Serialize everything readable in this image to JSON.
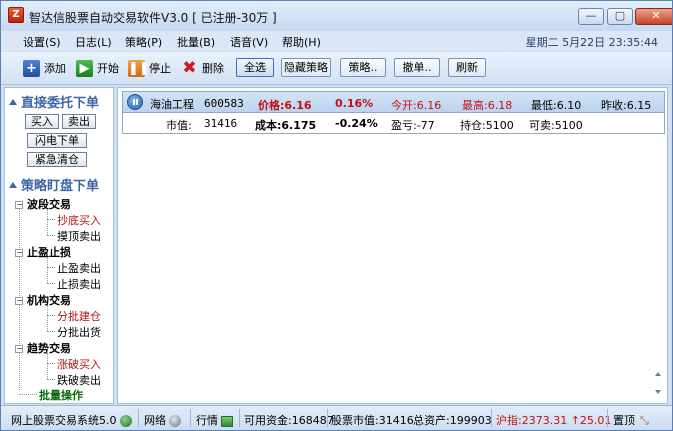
{
  "window": {
    "title": "智达信股票自动交易软件V3.0 [ 已注册-30万 ]",
    "app_icon_glyph": "Z",
    "controls": {
      "minimize": "—",
      "maximize": "▢",
      "close": "✕"
    }
  },
  "menu": {
    "items": [
      "设置(S)",
      "日志(L)",
      "策略(P)",
      "批量(B)",
      "语音(V)",
      "帮助(H)"
    ],
    "clock": "星期二  5月22日  23:35:44"
  },
  "toolbar": {
    "add": "添加",
    "start": "开始",
    "stop": "停止",
    "delete": "删除",
    "select_all": "全选",
    "hide_strategy": "隐藏策略",
    "strategy": "策略..",
    "cancel_order": "撤单..",
    "refresh": "刷新"
  },
  "left_panel": {
    "direct_title": "直接委托下单",
    "buy": "买入",
    "sell": "卖出",
    "flash_order": "闪电下单",
    "emergency_clear": "紧急清仓",
    "strategy_title": "策略盯盘下单",
    "groups": [
      {
        "label": "波段交易",
        "items": [
          {
            "label": "抄底买入",
            "color": "red"
          },
          {
            "label": "摸顶卖出",
            "color": "black"
          }
        ]
      },
      {
        "label": "止盈止损",
        "items": [
          {
            "label": "止盈卖出",
            "color": "black"
          },
          {
            "label": "止损卖出",
            "color": "black"
          }
        ]
      },
      {
        "label": "机构交易",
        "items": [
          {
            "label": "分批建仓",
            "color": "red"
          },
          {
            "label": "分批出货",
            "color": "black"
          }
        ]
      },
      {
        "label": "趋势交易",
        "items": [
          {
            "label": "涨破买入",
            "color": "red"
          },
          {
            "label": "跌破卖出",
            "color": "black"
          }
        ]
      }
    ],
    "batch": "批量操作"
  },
  "stock": {
    "name": "海油工程",
    "code": "600583",
    "price": "价格:6.16",
    "change_pct": "0.16%",
    "open": "今开:6.16",
    "high": "最高:6.18",
    "low": "最低:6.10",
    "prev_close": "昨收:6.15",
    "market_value_label": "市值:",
    "market_value": "31416",
    "cost": "成本:6.175",
    "cost_pct": "-0.24%",
    "pnl": "盈亏:-77",
    "position": "持仓:5100",
    "sellable": "可卖:5100"
  },
  "status": {
    "system": "网上股票交易系统5.0",
    "network": "网络",
    "quotes": "行情",
    "available": "可用资金:168487",
    "stock_value": "股票市值:31416",
    "total": "总资产:199903",
    "index": "沪指:2373.31 ↑25.01",
    "pin": "置顶",
    "colors": {
      "red": "#c01010",
      "accent": "#3d64a5"
    }
  }
}
